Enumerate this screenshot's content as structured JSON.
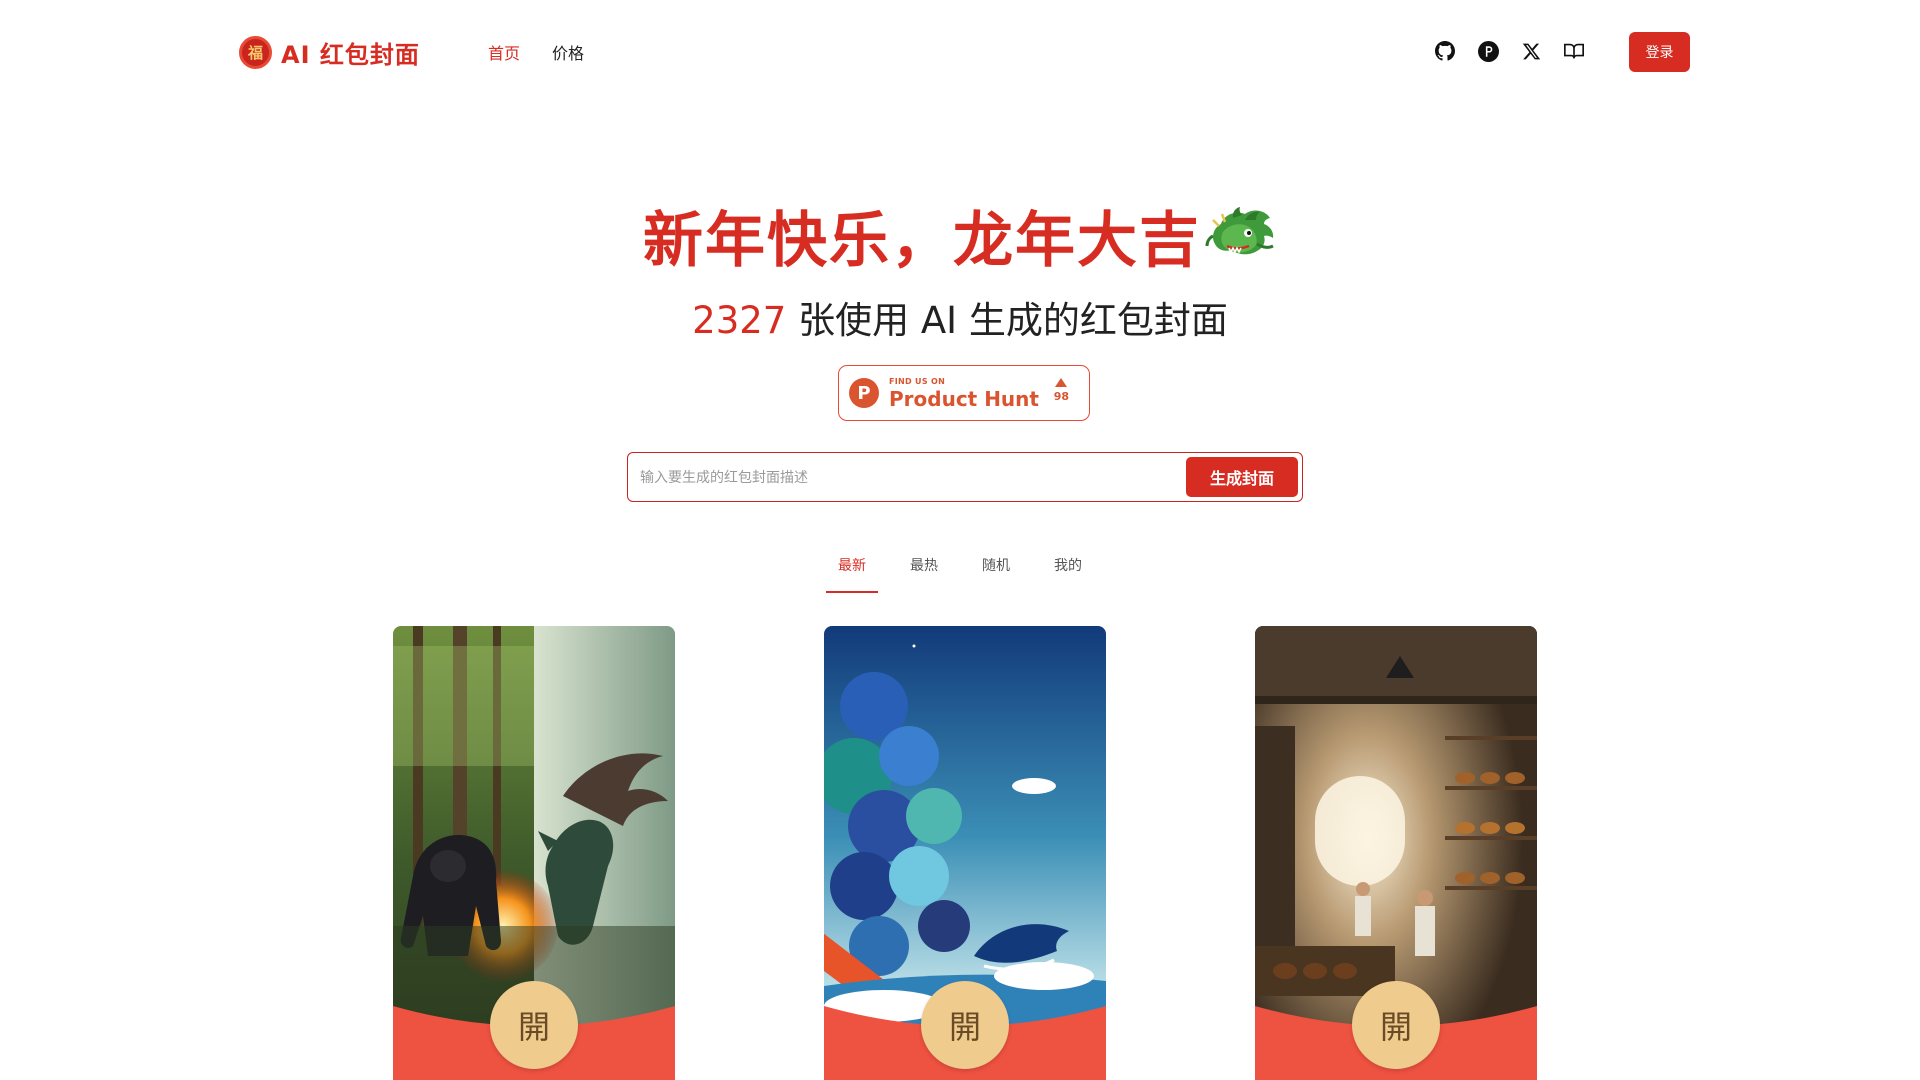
{
  "header": {
    "logo_text": "AI 红包封面",
    "logo_badge": "福",
    "nav": [
      {
        "label": "首页",
        "active": true
      },
      {
        "label": "价格",
        "active": false
      }
    ],
    "social_icons": [
      "github-icon",
      "product-hunt-icon",
      "x-icon",
      "book-icon"
    ],
    "login_label": "登录"
  },
  "hero": {
    "title": "新年快乐，龙年大吉",
    "title_emoji": "dragon-icon",
    "count": "2327",
    "subtitle": " 张使用 AI 生成的红包封面"
  },
  "product_hunt": {
    "small_text": "FIND US ON",
    "big_text": "Product Hunt",
    "letter": "P",
    "votes": "98"
  },
  "search": {
    "placeholder": "输入要生成的红包封面描述",
    "value": "",
    "button_label": "生成封面"
  },
  "tabs": [
    {
      "label": "最新",
      "active": true
    },
    {
      "label": "最热",
      "active": false
    },
    {
      "label": "随机",
      "active": false
    },
    {
      "label": "我的",
      "active": false
    }
  ],
  "cards": [
    {
      "seal": "開",
      "scene": "gorilla-vs-dragon"
    },
    {
      "seal": "開",
      "scene": "crayon-whale-waves"
    },
    {
      "seal": "開",
      "scene": "bakery-interior"
    }
  ],
  "colors": {
    "brand_red": "#d72c22",
    "envelope_red": "#ee5241",
    "seal_gold": "#efcb8e",
    "product_hunt": "#da552f"
  }
}
